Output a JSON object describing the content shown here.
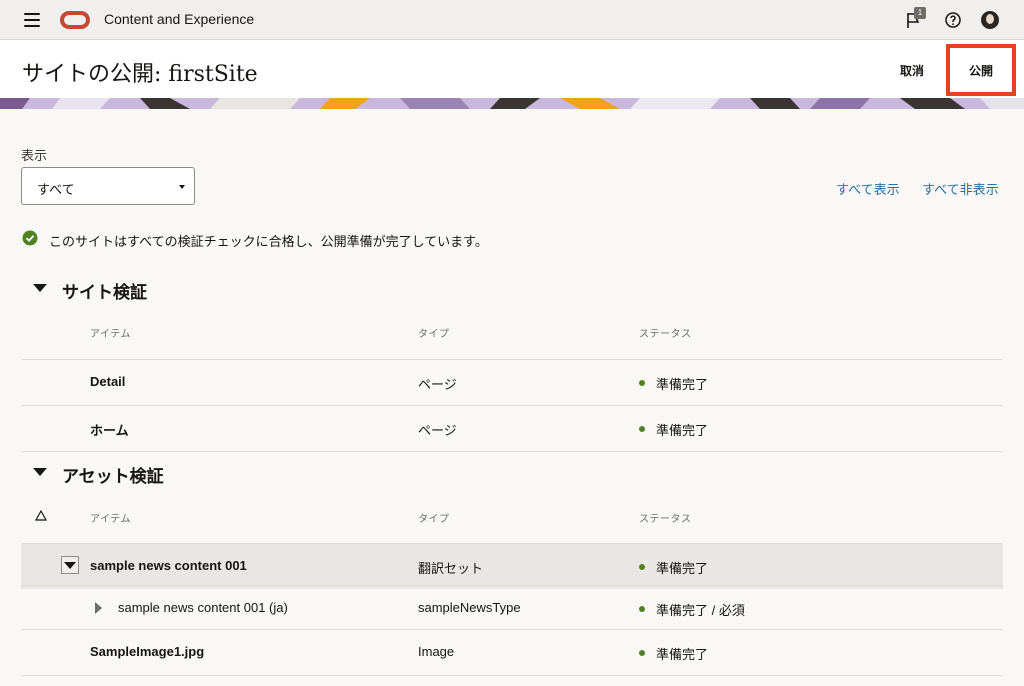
{
  "app": {
    "title": "Content and Experience",
    "notification_count": "1"
  },
  "header": {
    "title": "サイトの公開: firstSite",
    "cancel_label": "取消",
    "publish_label": "公開"
  },
  "filter": {
    "label": "表示",
    "selected": "すべて",
    "show_all": "すべて表示",
    "hide_all": "すべて非表示"
  },
  "status_message": "このサイトはすべての検証チェックに合格し、公開準備が完了しています。",
  "columns": {
    "item": "アイテム",
    "type": "タイプ",
    "status": "ステータス"
  },
  "site_validation": {
    "title": "サイト検証",
    "rows": [
      {
        "name": "Detail",
        "type": "ページ",
        "status": "準備完了"
      },
      {
        "name": "ホーム",
        "type": "ページ",
        "status": "準備完了"
      }
    ]
  },
  "asset_validation": {
    "title": "アセット検証",
    "rows": [
      {
        "name": "sample news content 001",
        "type": "翻訳セット",
        "status": "準備完了"
      },
      {
        "name": "sample news content 001 (ja)",
        "type": "sampleNewsType",
        "status": "準備完了 / 必須"
      },
      {
        "name": "SampleImage1.jpg",
        "type": "Image",
        "status": "準備完了"
      }
    ]
  },
  "colors": {
    "accent_red": "#e5401f",
    "ready_green": "#508223",
    "link_blue": "#2a6f9e"
  }
}
